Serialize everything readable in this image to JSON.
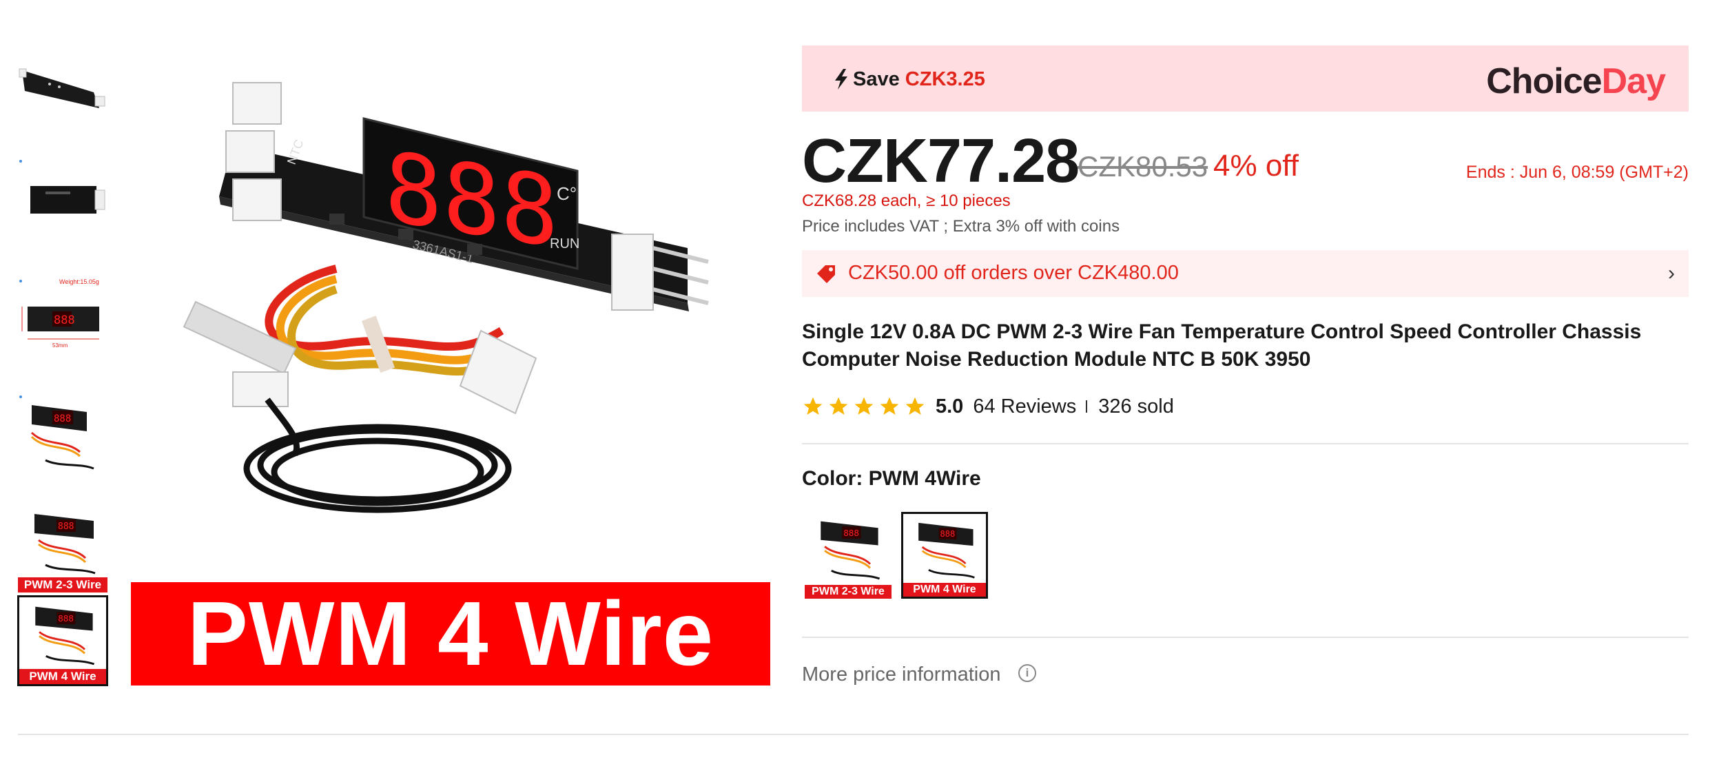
{
  "gallery": {
    "thumbnails": [
      {
        "caption": ""
      },
      {
        "caption": ""
      },
      {
        "caption": ""
      },
      {
        "caption": ""
      },
      {
        "caption": "PWM 2-3 Wire"
      },
      {
        "caption": "PWM 4 Wire"
      }
    ],
    "main_banner": "PWM 4 Wire",
    "display_digits": "888"
  },
  "promo": {
    "save_label": "Save",
    "save_amount": "CZK3.25",
    "brand_part1": "Choice",
    "brand_part2": "Day"
  },
  "price": {
    "current": "CZK77.28",
    "original": "CZK80.53",
    "discount": "4% off",
    "ends": "Ends :  Jun 6, 08:59 (GMT+2)",
    "bulk": "CZK68.28 each, ≥ 10 pieces",
    "vat_note": "Price includes VAT ; Extra 3% off with coins"
  },
  "coupon": {
    "text": "CZK50.00 off orders over CZK480.00"
  },
  "product": {
    "title": "Single 12V 0.8A DC PWM 2-3 Wire Fan Temperature Control Speed Controller Chassis Computer Noise Reduction Module NTC B 50K 3950"
  },
  "rating": {
    "stars": 5,
    "score": "5.0",
    "reviews": "64 Reviews",
    "sold": "326 sold"
  },
  "color": {
    "label": "Color: PWM 4Wire",
    "options": [
      {
        "caption": "PWM 2-3 Wire",
        "selected": false
      },
      {
        "caption": "PWM 4 Wire",
        "selected": true
      }
    ]
  },
  "more_price": {
    "label": "More price information"
  },
  "colors": {
    "accent_red": "#e1251b",
    "promo_bg": "#ffdde0",
    "coupon_bg": "#fff0f1",
    "star": "#f7b500"
  }
}
